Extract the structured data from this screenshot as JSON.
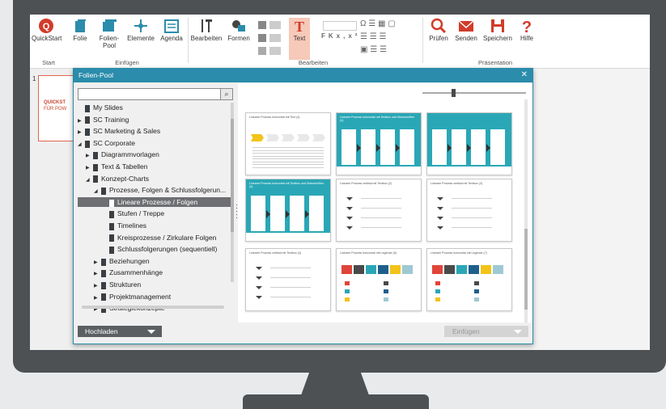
{
  "ribbon": {
    "buttons": [
      {
        "label": "QuickStart",
        "icon": "quickstart-icon"
      },
      {
        "label": "Folie",
        "icon": "slide-icon"
      },
      {
        "label": "Folien-Pool",
        "icon": "slide-pool-icon"
      },
      {
        "label": "Elemente",
        "icon": "elements-icon"
      },
      {
        "label": "Agenda",
        "icon": "agenda-icon"
      },
      {
        "label": "Bearbeiten",
        "icon": "edit-icon"
      },
      {
        "label": "Formen",
        "icon": "shapes-icon"
      },
      {
        "label": "Text",
        "icon": "text-icon"
      },
      {
        "label": "Prüfen",
        "icon": "search-icon"
      },
      {
        "label": "Senden",
        "icon": "mail-icon"
      },
      {
        "label": "Speichern",
        "icon": "save-icon"
      },
      {
        "label": "Hilfe",
        "icon": "help-icon"
      }
    ],
    "groups": [
      "Start",
      "Einfügen",
      "Bearbeiten",
      "Präsentation"
    ],
    "font_glyphs": [
      "F",
      "K",
      "x,",
      "x²"
    ]
  },
  "slide": {
    "number": "1",
    "title_line1": "QUICKST",
    "title_line2": "FÜR POW"
  },
  "dialog": {
    "title": "Folien-Pool",
    "close": "✕",
    "search_placeholder": "",
    "tree": [
      {
        "label": "My Slides",
        "level": 0,
        "arrow": ""
      },
      {
        "label": "SC Training",
        "level": 0,
        "arrow": "▶"
      },
      {
        "label": "SC Marketing & Sales",
        "level": 0,
        "arrow": "▶"
      },
      {
        "label": "SC Corporate",
        "level": 0,
        "arrow": "◢"
      },
      {
        "label": "Diagrammvorlagen",
        "level": 1,
        "arrow": "▶"
      },
      {
        "label": "Text & Tabellen",
        "level": 1,
        "arrow": "▶"
      },
      {
        "label": "Konzept-Charts",
        "level": 1,
        "arrow": "◢"
      },
      {
        "label": "Prozesse, Folgen & Schlussfolgerun...",
        "level": 2,
        "arrow": "◢"
      },
      {
        "label": "Lineare Prozesse / Folgen",
        "level": 3,
        "arrow": "",
        "selected": true
      },
      {
        "label": "Stufen / Treppe",
        "level": 3,
        "arrow": ""
      },
      {
        "label": "Timelines",
        "level": 3,
        "arrow": ""
      },
      {
        "label": "Kreisprozesse / Zirkulare Folgen",
        "level": 3,
        "arrow": ""
      },
      {
        "label": "Schlussfolgerungen (sequentiell)",
        "level": 3,
        "arrow": ""
      },
      {
        "label": "Beziehungen",
        "level": 2,
        "arrow": "▶"
      },
      {
        "label": "Zusammenhänge",
        "level": 2,
        "arrow": "▶"
      },
      {
        "label": "Strukturen",
        "level": 2,
        "arrow": "▶"
      },
      {
        "label": "Projektmanagement",
        "level": 2,
        "arrow": "▶"
      },
      {
        "label": "Strategiekonzepte",
        "level": 2,
        "arrow": "▶"
      }
    ],
    "upload_label": "Hochladen",
    "insert_label": "Einfügen",
    "thumbnails": [
      {
        "title": "Linearer Prozess horizontal mit Text (4)",
        "style": "white"
      },
      {
        "title": "Linearer Prozess horizontal mit Textbox und Überschriften (4)",
        "style": "teal"
      },
      {
        "title": "",
        "style": "teal"
      },
      {
        "title": "Linearer Prozess horizontal mit Textbox und Überschriften (5)",
        "style": "teal"
      },
      {
        "title": "Linearer Prozess vertikal mit Textbox (2)",
        "style": "white"
      },
      {
        "title": "Linearer Prozess vertikal mit Textbox (3)",
        "style": "white"
      },
      {
        "title": "Linearer Prozess vertikal mit Textbox (4)",
        "style": "white"
      },
      {
        "title": "Linearer Prozess horizontal mit Legende (6)",
        "style": "white"
      },
      {
        "title": "Linearer Prozess horizontal mit Legende (7)",
        "style": "white"
      }
    ],
    "legend_colors": [
      "#e0443a",
      "#4a4a4a",
      "#2aa7b6",
      "#1f5f8b",
      "#f2c318",
      "#9ec9d3"
    ]
  }
}
